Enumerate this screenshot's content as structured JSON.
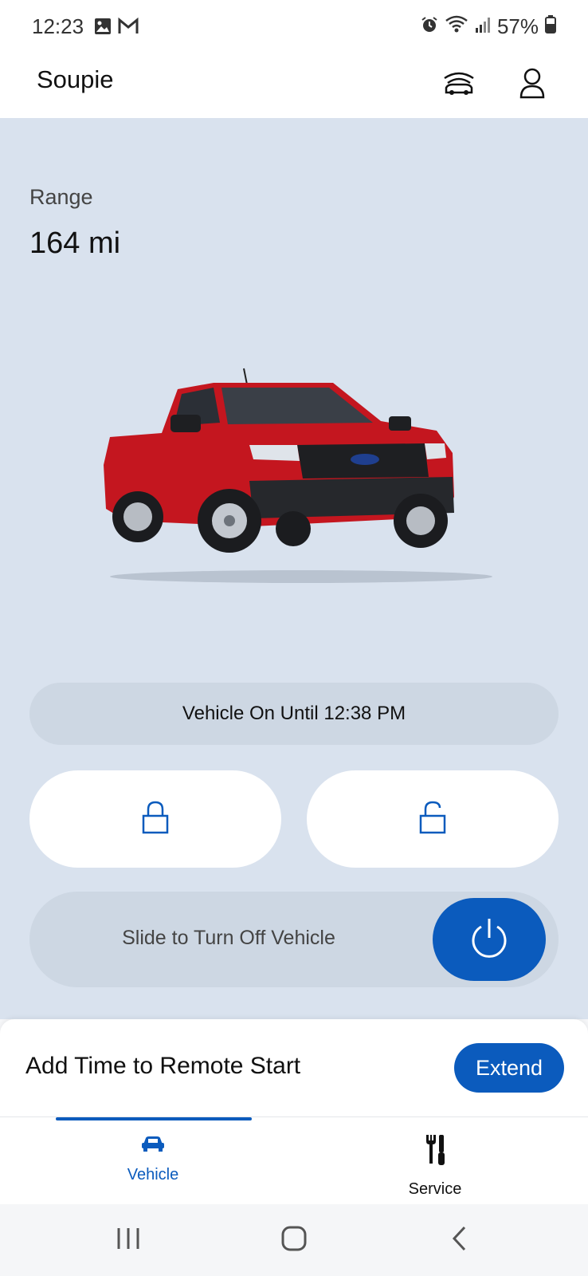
{
  "status_bar": {
    "time": "12:23",
    "battery": "57%"
  },
  "header": {
    "title": "Soupie"
  },
  "vehicle": {
    "range_label": "Range",
    "range_value": "164 mi",
    "status": "Vehicle On Until 12:38 PM",
    "slider_label": "Slide to Turn Off Vehicle"
  },
  "remote_start": {
    "text": "Add Time to Remote Start",
    "button": "Extend"
  },
  "bottom_nav": {
    "items": [
      {
        "label": "Vehicle",
        "active": true
      },
      {
        "label": "Service",
        "active": false
      }
    ]
  },
  "colors": {
    "accent": "#0b5bbd",
    "background": "#d9e2ee",
    "truck_body": "#c4161f"
  }
}
